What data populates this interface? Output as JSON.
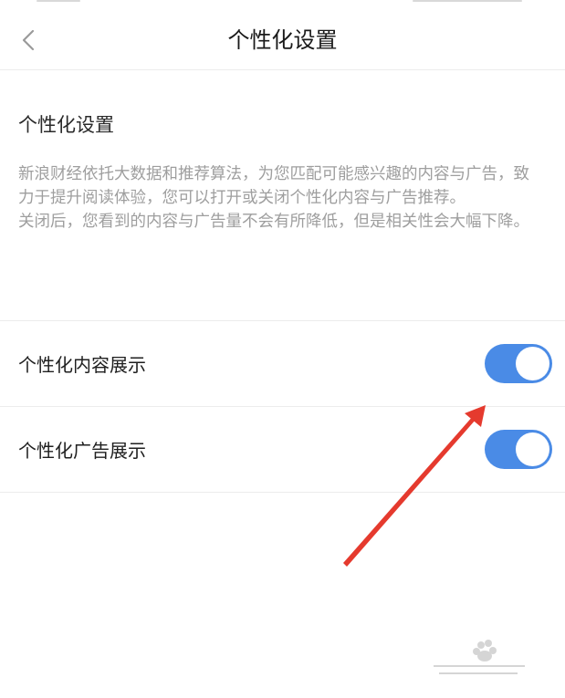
{
  "header": {
    "title": "个性化设置",
    "back_icon": "chevron-left-icon"
  },
  "intro": {
    "heading": "个性化设置",
    "description_1": "新浪财经依托大数据和推荐算法，为您匹配可能感兴趣的内容与广告，致力于提升阅读体验，您可以打开或关闭个性化内容与广告推荐。",
    "description_2": "关闭后，您看到的内容与广告量不会有所降低，但是相关性会大幅下降。"
  },
  "settings": [
    {
      "label": "个性化内容展示",
      "enabled": true
    },
    {
      "label": "个性化广告展示",
      "enabled": true
    }
  ],
  "colors": {
    "toggle_on": "#4a8be6",
    "annotation_arrow": "#e53a2e",
    "separator": "#ececec"
  }
}
